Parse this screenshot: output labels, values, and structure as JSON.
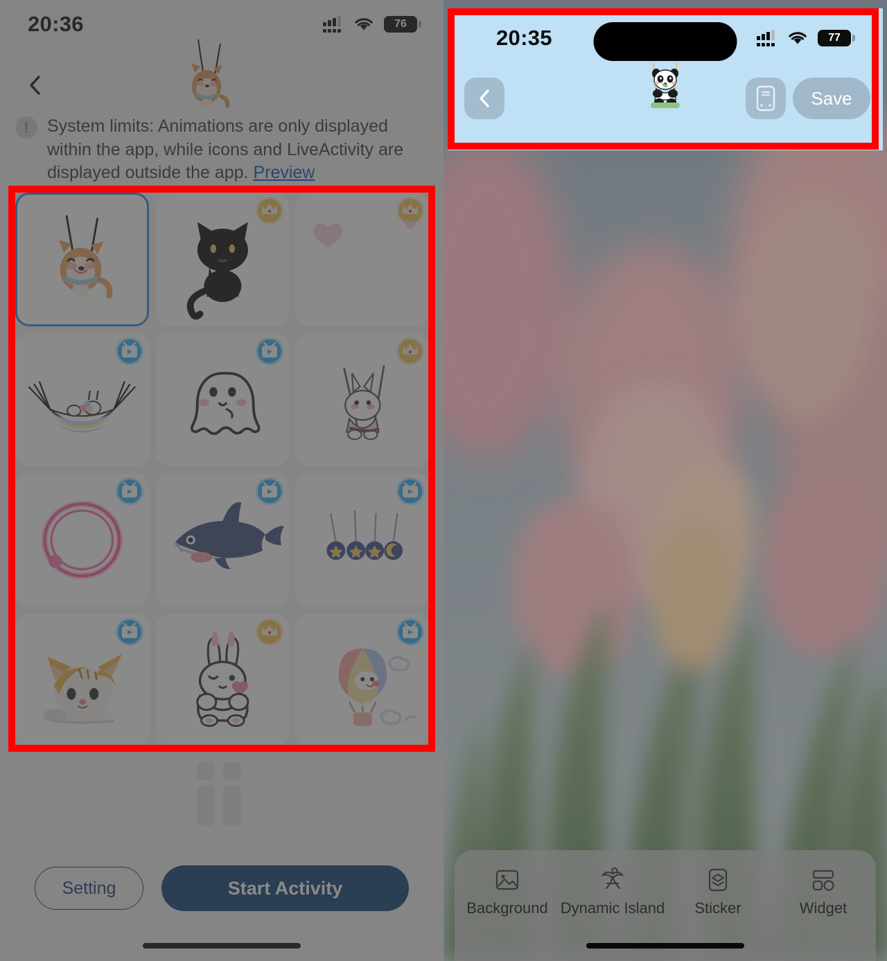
{
  "left_phone": {
    "status_bar": {
      "time": "20:36",
      "battery": "76",
      "cellular_icon": "cellular-signal-icon",
      "wifi_icon": "wifi-icon"
    },
    "nav": {
      "back_icon": "chevron-left-icon"
    },
    "hero_sticker": {
      "name": "shiba-dog-on-swing-sticker"
    },
    "notice": {
      "icon": "!",
      "text": "System limits: Animations are only displayed within the app, while icons and LiveActivity are displayed outside the app. ",
      "link_label": "Preview"
    },
    "sticker_grid": {
      "items": [
        {
          "name": "shiba-dog-on-swing",
          "badge": "none",
          "selected": true
        },
        {
          "name": "black-cat",
          "badge": "crown",
          "selected": false
        },
        {
          "name": "pink-heart",
          "badge": "crown",
          "selected": false
        },
        {
          "name": "bunny-in-hammock",
          "badge": "video",
          "selected": false
        },
        {
          "name": "white-ghost",
          "badge": "video",
          "selected": false
        },
        {
          "name": "bunny-on-swing",
          "badge": "crown",
          "selected": false
        },
        {
          "name": "pink-neon-ring",
          "badge": "video",
          "selected": false
        },
        {
          "name": "blue-shark",
          "badge": "video",
          "selected": false
        },
        {
          "name": "hanging-star-charms",
          "badge": "video",
          "selected": false
        },
        {
          "name": "orange-tabby-cat",
          "badge": "video",
          "selected": false
        },
        {
          "name": "white-bunny-heart",
          "badge": "crown",
          "selected": false
        },
        {
          "name": "hot-air-balloon",
          "badge": "video",
          "selected": false
        }
      ]
    },
    "bottom_bar": {
      "setting_label": "Setting",
      "start_label": "Start Activity"
    }
  },
  "right_phone": {
    "status_bar": {
      "time": "20:35",
      "battery": "77",
      "cellular_icon": "cellular-signal-icon",
      "wifi_icon": "wifi-icon"
    },
    "dynamic_island": {
      "name": "dynamic-island"
    },
    "sticker": {
      "name": "panda-on-bamboo-swing-sticker"
    },
    "top_bar": {
      "back_icon": "chevron-left-icon",
      "phone_icon": "phone-preview-icon",
      "save_label": "Save"
    },
    "wallpaper": {
      "name": "pink-tulips-photo"
    },
    "toolbar": {
      "items": [
        {
          "label": "Background",
          "icon": "image-icon"
        },
        {
          "label": "Dynamic Island",
          "icon": "palm-tree-island-icon"
        },
        {
          "label": "Sticker",
          "icon": "layers-icon"
        },
        {
          "label": "Widget",
          "icon": "widget-grid-icon"
        }
      ]
    }
  },
  "annotations": {
    "boxes": [
      {
        "name": "sticker-grid-highlight",
        "color": "#ff0000"
      },
      {
        "name": "top-bar-highlight",
        "color": "#ff0000"
      }
    ]
  }
}
